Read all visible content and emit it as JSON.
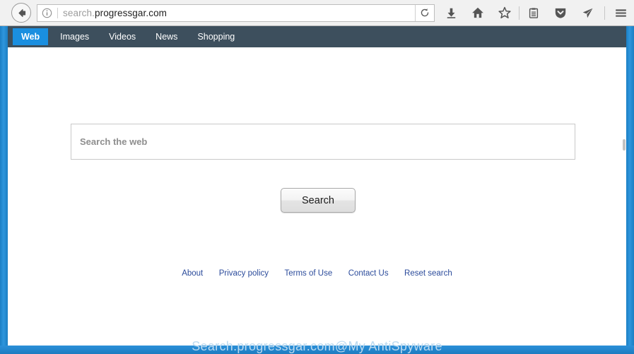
{
  "browser": {
    "back_icon": "back-arrow-icon",
    "info_icon": "info-icon",
    "url_prefix": "search.",
    "url_domain": "progressgar.com",
    "url_full": "search.progressgar.com",
    "reload_icon": "reload-icon",
    "toolbar_icons": [
      {
        "name": "download-icon",
        "glyph": "download"
      },
      {
        "name": "home-icon",
        "glyph": "home"
      },
      {
        "name": "bookmark-star-icon",
        "glyph": "star"
      },
      {
        "name": "library-icon",
        "glyph": "library"
      },
      {
        "name": "pocket-shield-icon",
        "glyph": "shield"
      },
      {
        "name": "send-page-icon",
        "glyph": "paper-plane"
      },
      {
        "name": "menu-hamburger-icon",
        "glyph": "hamburger"
      }
    ]
  },
  "site": {
    "nav": [
      {
        "label": "Web",
        "active": true
      },
      {
        "label": "Images",
        "active": false
      },
      {
        "label": "Videos",
        "active": false
      },
      {
        "label": "News",
        "active": false
      },
      {
        "label": "Shopping",
        "active": false
      }
    ],
    "search": {
      "value": "",
      "placeholder": "Search the web",
      "button_label": "Search"
    },
    "footer_links": [
      "About",
      "Privacy policy",
      "Terms of Use",
      "Contact Us",
      "Reset search"
    ],
    "watermark": "Search.progressgar.com@My AntiSpyware"
  },
  "colors": {
    "nav_background": "#3d4f5d",
    "nav_active": "#1a8fe0",
    "link": "#2b4b9b",
    "band": "#2b90d9",
    "watermark": "#bcdaf0"
  }
}
